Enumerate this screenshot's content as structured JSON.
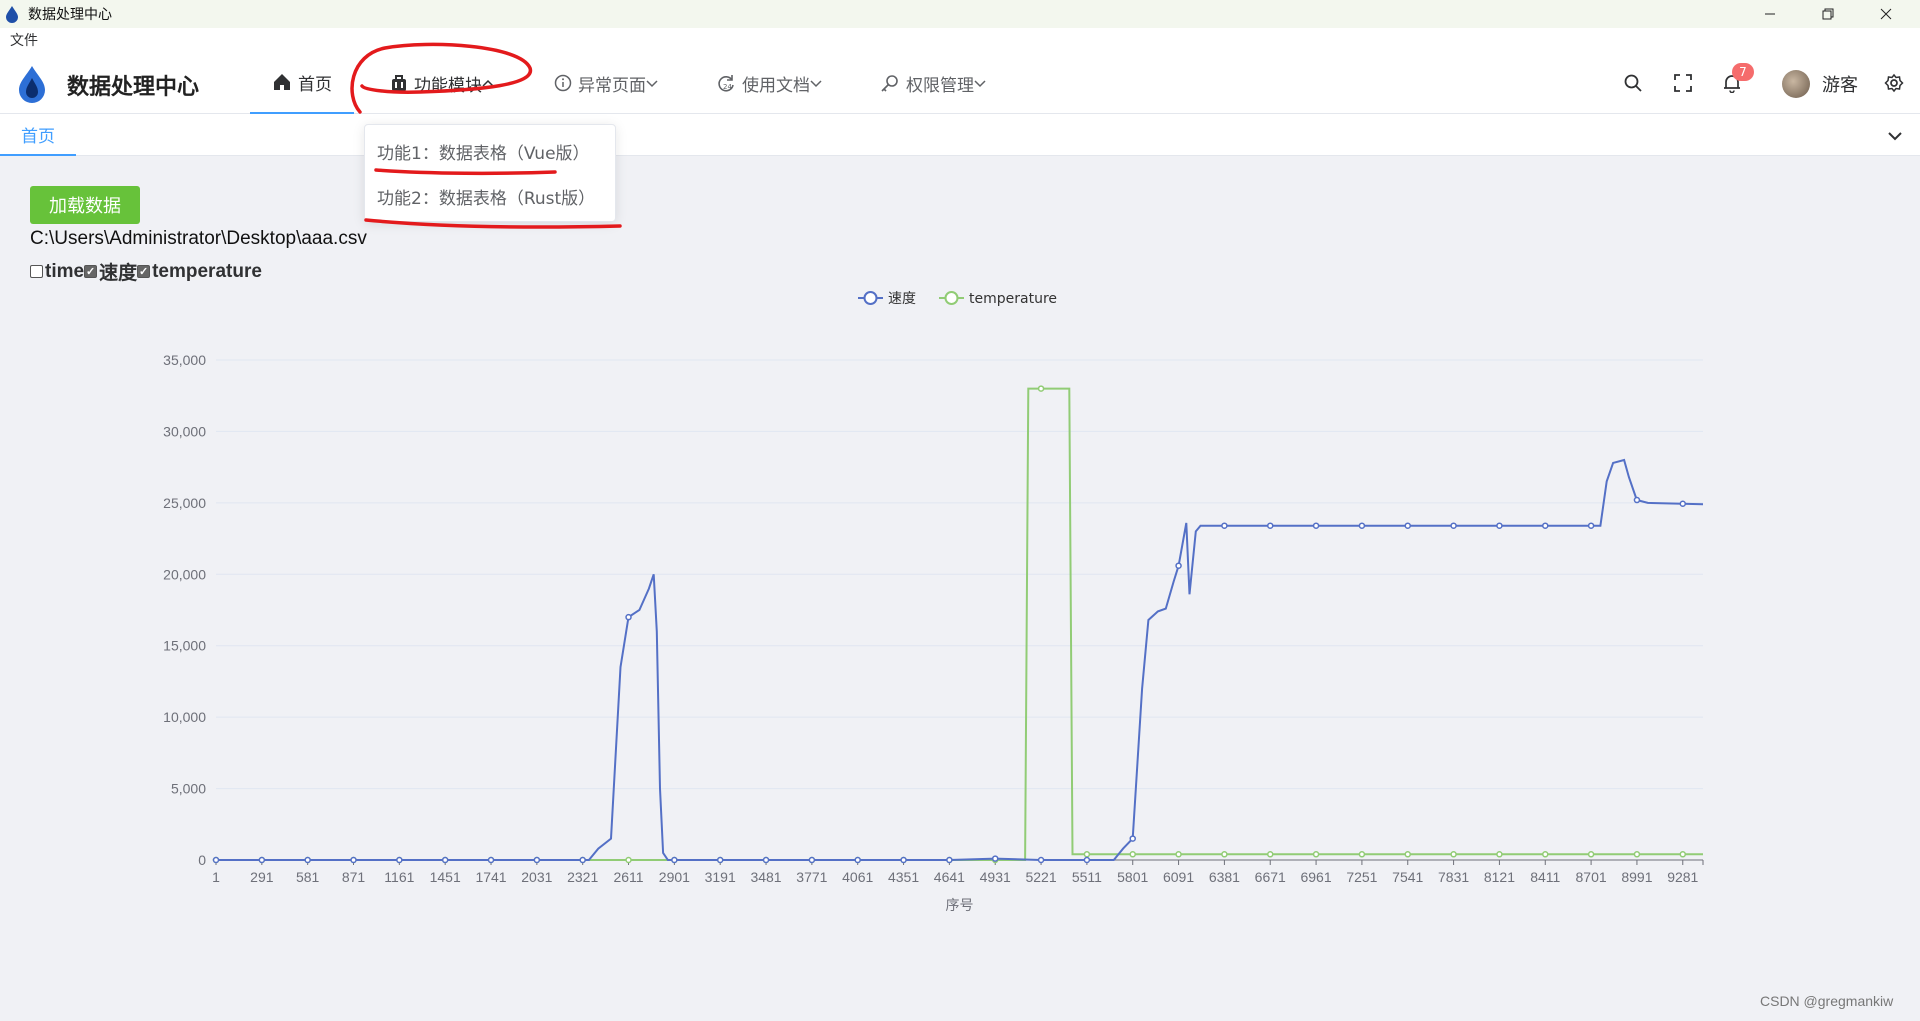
{
  "window": {
    "title": "数据处理中心"
  },
  "menu": {
    "file": "文件"
  },
  "header": {
    "brand": "数据处理中心",
    "nav": [
      {
        "label": "首页",
        "icon": "home-icon"
      },
      {
        "label": "功能模块",
        "icon": "bag-icon"
      },
      {
        "label": "异常页面",
        "icon": "info-icon"
      },
      {
        "label": "使用文档",
        "icon": "refresh-24-icon"
      },
      {
        "label": "权限管理",
        "icon": "key-icon"
      }
    ],
    "notification_count": "7",
    "user": "游客"
  },
  "tabs": [
    {
      "label": "首页"
    }
  ],
  "dropdown": {
    "items": [
      "功能1：数据表格（Vue版）",
      "功能2：数据表格（Rust版）"
    ]
  },
  "main": {
    "load_button": "加载数据",
    "file_path": "C:\\Users\\Administrator\\Desktop\\aaa.csv",
    "checkboxes": [
      {
        "label": "time",
        "checked": false
      },
      {
        "label": "速度",
        "checked": true
      },
      {
        "label": "temperature",
        "checked": true
      }
    ]
  },
  "colors": {
    "speed": "#5470c6",
    "temperature": "#91cc75",
    "accent": "#409eff",
    "button": "#67c23a",
    "badge": "#f56c6c"
  },
  "chart_data": {
    "type": "line",
    "xlabel": "序号",
    "ylabel": "",
    "x_range": [
      1,
      9409
    ],
    "ylim": [
      0,
      35000
    ],
    "y_ticks": [
      "0",
      "5,000",
      "10,000",
      "15,000",
      "20,000",
      "25,000",
      "30,000",
      "35,000"
    ],
    "x_ticks": [
      "1",
      "291",
      "581",
      "871",
      "1161",
      "1451",
      "1741",
      "2031",
      "2321",
      "2611",
      "2901",
      "3191",
      "3481",
      "3771",
      "4061",
      "4351",
      "4641",
      "4931",
      "5221",
      "5511",
      "5801",
      "6091",
      "6381",
      "6671",
      "6961",
      "7251",
      "7541",
      "7831",
      "8121",
      "8411",
      "8701",
      "8991",
      "9281"
    ],
    "legend_position": "top-center",
    "series": [
      {
        "name": "速度",
        "points": [
          [
            1,
            0
          ],
          [
            2360,
            0
          ],
          [
            2420,
            800
          ],
          [
            2500,
            1500
          ],
          [
            2560,
            13500
          ],
          [
            2611,
            17000
          ],
          [
            2680,
            17500
          ],
          [
            2740,
            19000
          ],
          [
            2770,
            20000
          ],
          [
            2790,
            16000
          ],
          [
            2810,
            5000
          ],
          [
            2830,
            500
          ],
          [
            2860,
            0
          ],
          [
            4641,
            0
          ],
          [
            4931,
            100
          ],
          [
            5221,
            0
          ],
          [
            5681,
            0
          ],
          [
            5740,
            800
          ],
          [
            5801,
            1500
          ],
          [
            5860,
            12000
          ],
          [
            5900,
            16800
          ],
          [
            5960,
            17400
          ],
          [
            6010,
            17600
          ],
          [
            6060,
            19500
          ],
          [
            6091,
            20600
          ],
          [
            6140,
            23600
          ],
          [
            6160,
            18600
          ],
          [
            6200,
            23000
          ],
          [
            6230,
            23400
          ],
          [
            8720,
            23400
          ],
          [
            8760,
            23400
          ],
          [
            8800,
            26500
          ],
          [
            8840,
            27800
          ],
          [
            8910,
            28000
          ],
          [
            8940,
            26800
          ],
          [
            8990,
            25200
          ],
          [
            9060,
            25000
          ],
          [
            9409,
            24900
          ]
        ]
      },
      {
        "name": "temperature",
        "points": [
          [
            1,
            0
          ],
          [
            5120,
            0
          ],
          [
            5140,
            33000
          ],
          [
            5400,
            33000
          ],
          [
            5420,
            400
          ],
          [
            9409,
            400
          ]
        ]
      }
    ]
  },
  "watermark": "CSDN @gregmankiw"
}
